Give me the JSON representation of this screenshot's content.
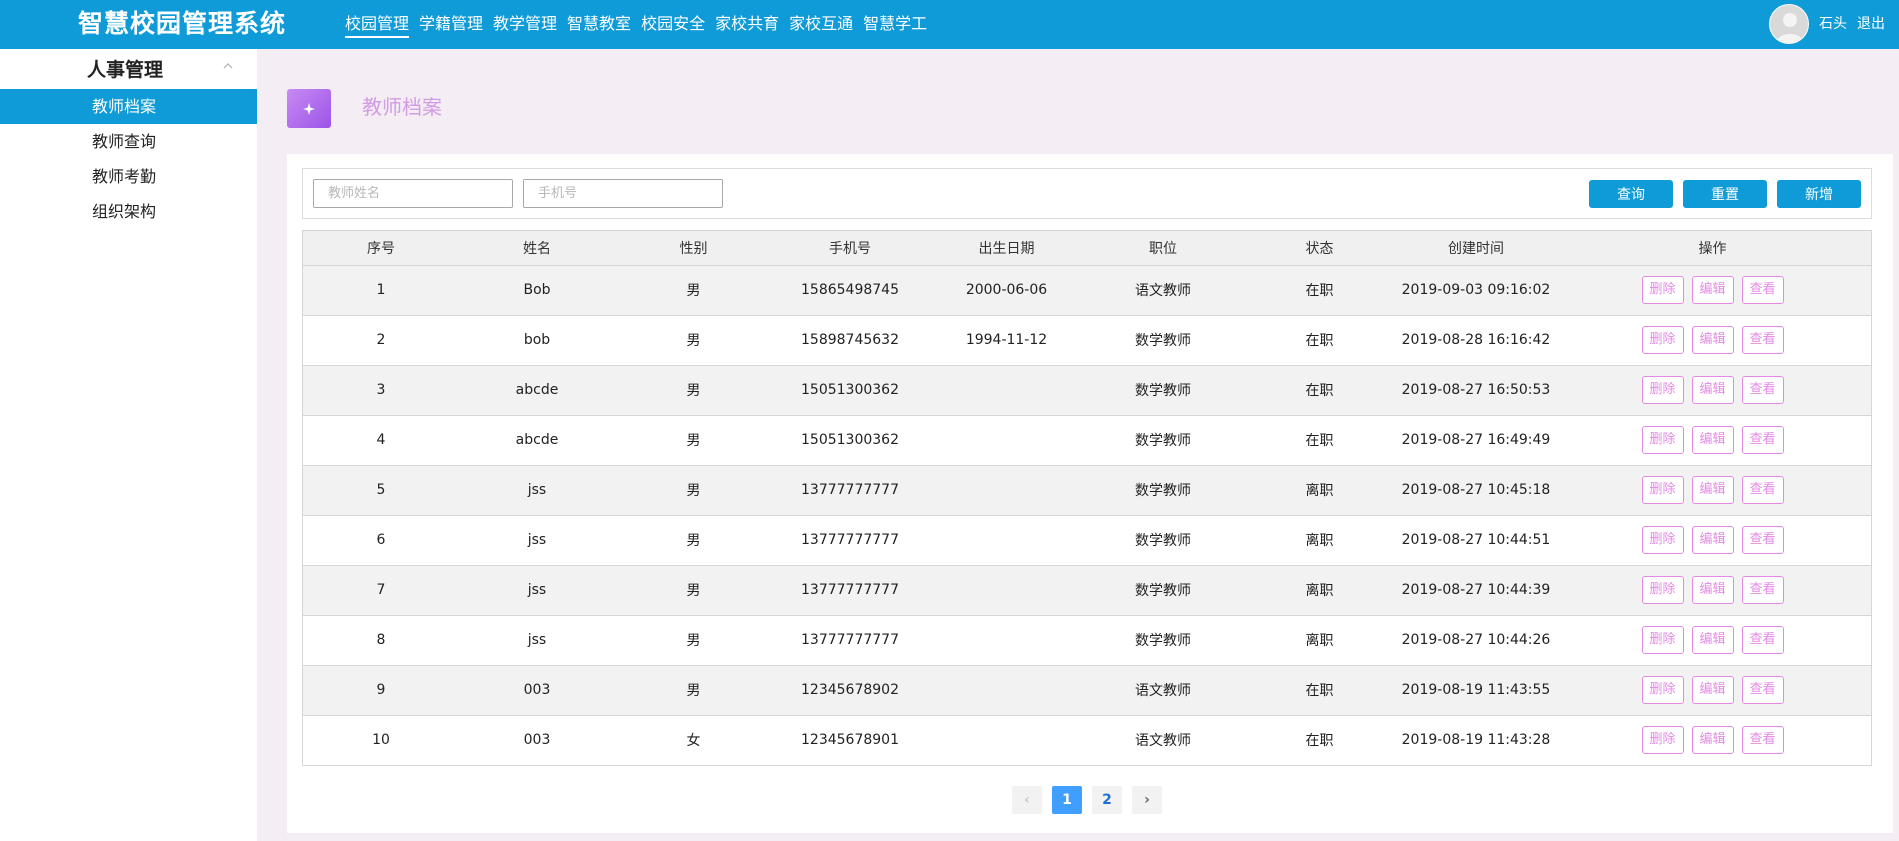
{
  "app": {
    "title": "智慧校园管理系统"
  },
  "nav": {
    "items": [
      "校园管理",
      "学籍管理",
      "教学管理",
      "智慧教室",
      "校园安全",
      "家校共育",
      "家校互通",
      "智慧学工"
    ],
    "active_index": 0
  },
  "user": {
    "name": "石头",
    "logout": "退出"
  },
  "sidebar": {
    "group_title": "人事管理",
    "items": [
      "教师档案",
      "教师查询",
      "教师考勤",
      "组织架构"
    ],
    "active_index": 0
  },
  "page": {
    "title": "教师档案",
    "icon": "sparkle-icon"
  },
  "filters": {
    "name_placeholder": "教师姓名",
    "phone_placeholder": "手机号",
    "query_label": "查询",
    "reset_label": "重置",
    "add_label": "新增"
  },
  "table": {
    "columns": [
      "序号",
      "姓名",
      "性别",
      "手机号",
      "出生日期",
      "职位",
      "状态",
      "创建时间",
      "操作"
    ],
    "actions": [
      "删除",
      "编辑",
      "查看"
    ],
    "rows": [
      [
        "1",
        "Bob",
        "男",
        "15865498745",
        "2000-06-06",
        "语文教师",
        "在职",
        "2019-09-03 09:16:02"
      ],
      [
        "2",
        "bob",
        "男",
        "15898745632",
        "1994-11-12",
        "数学教师",
        "在职",
        "2019-08-28 16:16:42"
      ],
      [
        "3",
        "abcde",
        "男",
        "15051300362",
        "",
        "数学教师",
        "在职",
        "2019-08-27 16:50:53"
      ],
      [
        "4",
        "abcde",
        "男",
        "15051300362",
        "",
        "数学教师",
        "在职",
        "2019-08-27 16:49:49"
      ],
      [
        "5",
        "jss",
        "男",
        "13777777777",
        "",
        "数学教师",
        "离职",
        "2019-08-27 10:45:18"
      ],
      [
        "6",
        "jss",
        "男",
        "13777777777",
        "",
        "数学教师",
        "离职",
        "2019-08-27 10:44:51"
      ],
      [
        "7",
        "jss",
        "男",
        "13777777777",
        "",
        "数学教师",
        "离职",
        "2019-08-27 10:44:39"
      ],
      [
        "8",
        "jss",
        "男",
        "13777777777",
        "",
        "数学教师",
        "离职",
        "2019-08-27 10:44:26"
      ],
      [
        "9",
        "003",
        "男",
        "12345678902",
        "",
        "语文教师",
        "在职",
        "2019-08-19 11:43:55"
      ],
      [
        "10",
        "003",
        "女",
        "12345678901",
        "",
        "语文教师",
        "在职",
        "2019-08-19 11:43:28"
      ]
    ]
  },
  "pagination": {
    "pages": [
      "1",
      "2"
    ],
    "current": "1",
    "prev": "‹",
    "next": "›"
  },
  "colors": {
    "primary": "#0e9bd8",
    "action": "#e48ae6",
    "page_title": "#d39ae6",
    "pager_active": "#409eff"
  }
}
